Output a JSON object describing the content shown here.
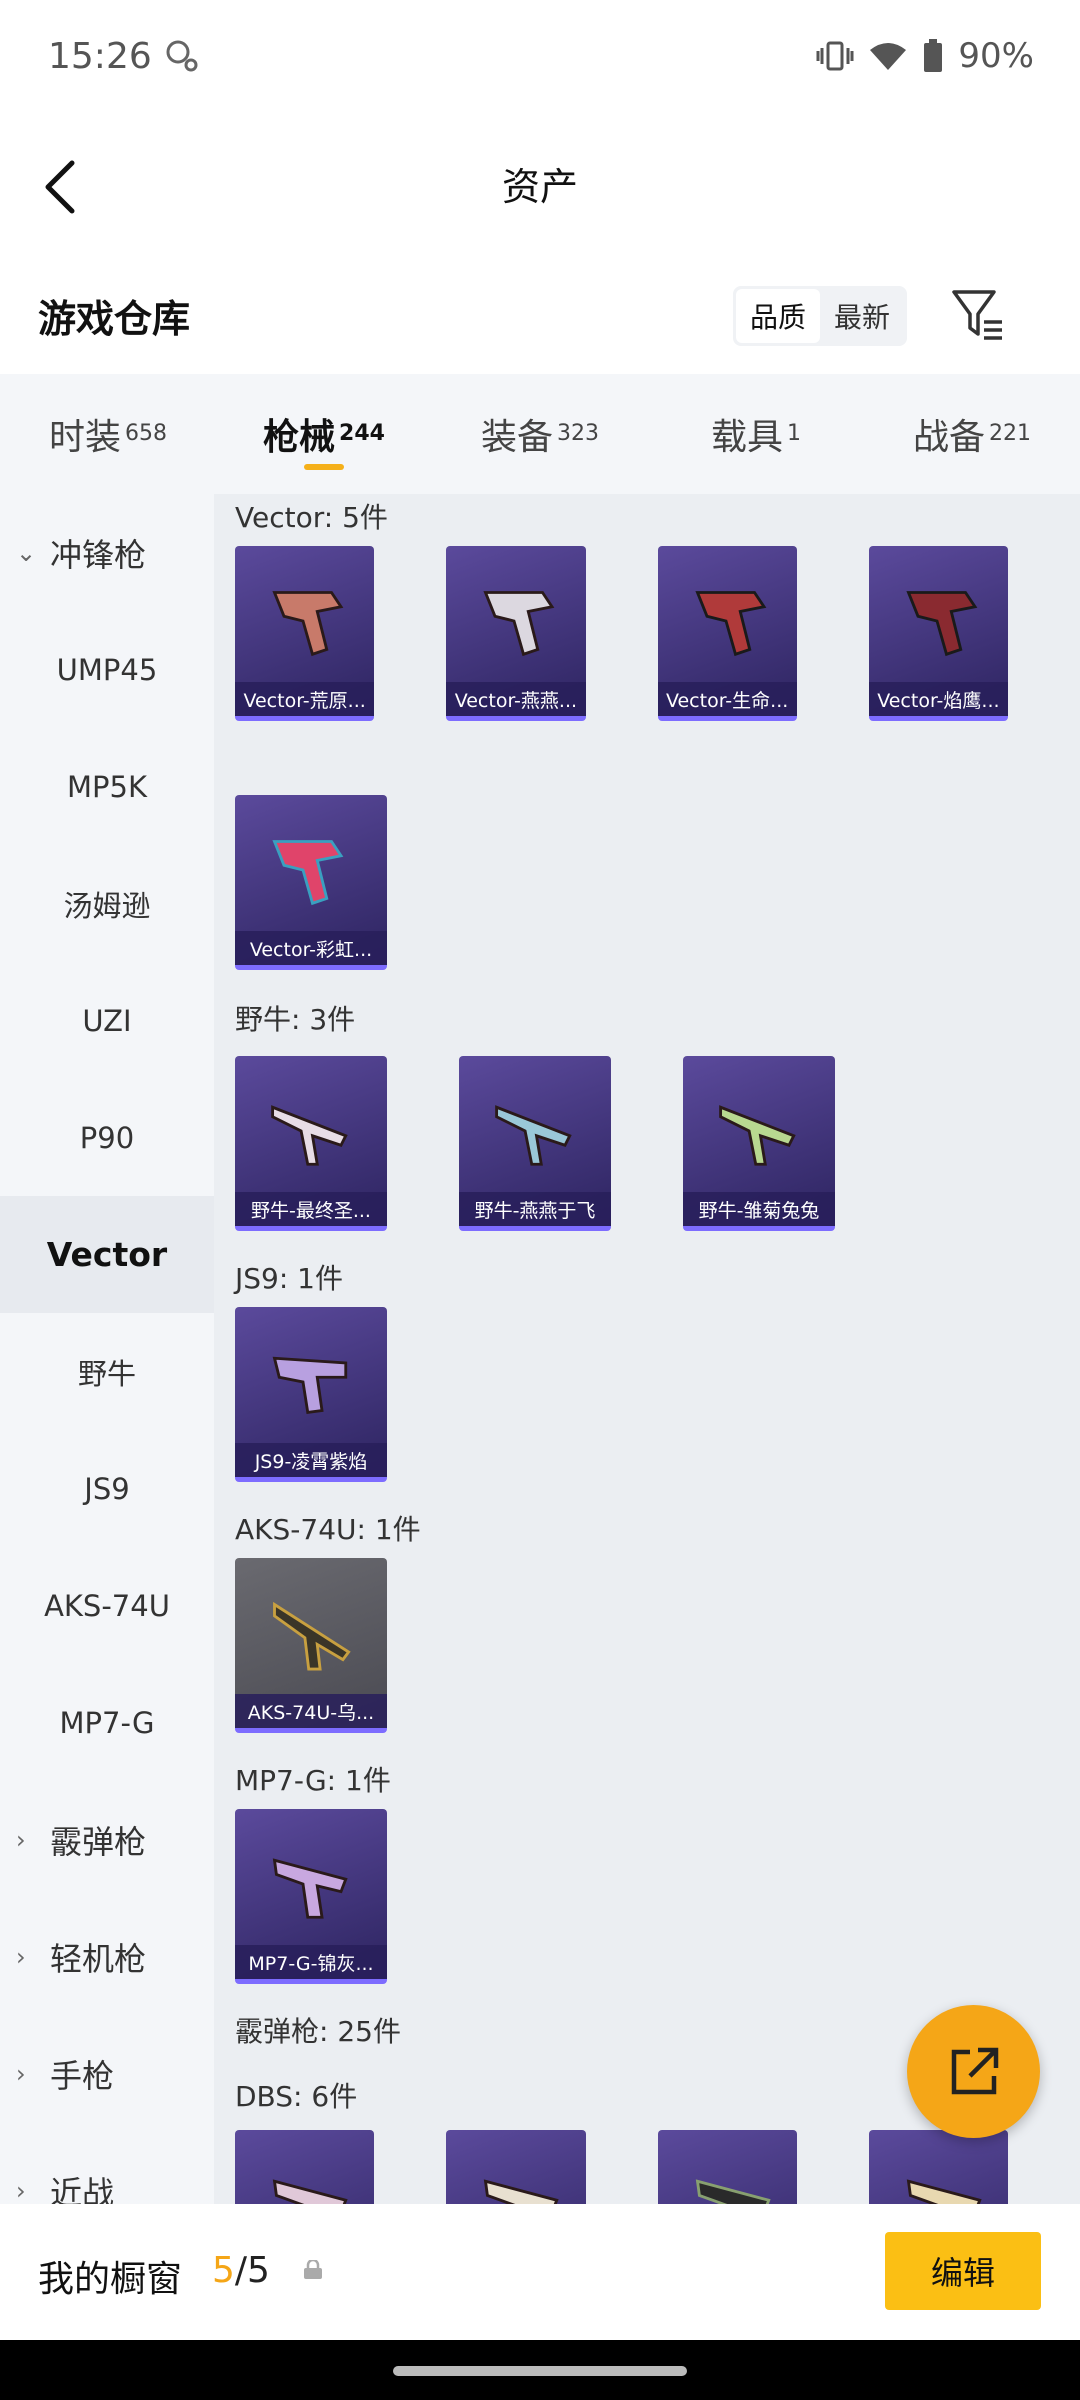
{
  "status": {
    "time": "15:26",
    "battery": "90%"
  },
  "nav": {
    "title": "资产"
  },
  "header": {
    "title": "游戏仓库",
    "sort_options": [
      "品质",
      "最新"
    ]
  },
  "tabs": [
    {
      "label": "时装",
      "count": "658"
    },
    {
      "label": "枪械",
      "count": "244"
    },
    {
      "label": "装备",
      "count": "323"
    },
    {
      "label": "载具",
      "count": "1"
    },
    {
      "label": "战备",
      "count": "221"
    }
  ],
  "sidebar": [
    {
      "label": "冲锋枪",
      "type": "category",
      "expanded": true
    },
    {
      "label": "UMP45"
    },
    {
      "label": "MP5K"
    },
    {
      "label": "汤姆逊"
    },
    {
      "label": "UZI"
    },
    {
      "label": "P90"
    },
    {
      "label": "Vector",
      "selected": true
    },
    {
      "label": "野牛"
    },
    {
      "label": "JS9"
    },
    {
      "label": "AKS-74U"
    },
    {
      "label": "MP7-G"
    },
    {
      "label": "霰弹枪",
      "type": "category"
    },
    {
      "label": "轻机枪",
      "type": "category"
    },
    {
      "label": "手枪",
      "type": "category"
    },
    {
      "label": "近战",
      "type": "category"
    }
  ],
  "sections": [
    {
      "title": "Vector: 5件",
      "items": [
        "Vector-荒原...",
        "Vector-燕燕...",
        "Vector-生命...",
        "Vector-焰鹰...",
        "Vector-彩虹..."
      ]
    },
    {
      "title": "野牛: 3件",
      "items": [
        "野牛-最终圣...",
        "野牛-燕燕于飞",
        "野牛-雏菊兔兔"
      ]
    },
    {
      "title": "JS9: 1件",
      "items": [
        "JS9-凌霄紫焰"
      ]
    },
    {
      "title": "AKS-74U: 1件",
      "items": [
        "AKS-74U-乌..."
      ]
    },
    {
      "title": "MP7-G: 1件",
      "items": [
        "MP7-G-锦灰..."
      ]
    },
    {
      "title": "霰弹枪: 25件",
      "items": []
    },
    {
      "title": "DBS: 6件",
      "items": [
        "",
        "",
        "",
        ""
      ]
    }
  ],
  "bottom": {
    "label": "我的橱窗",
    "count_current": "5",
    "count_total": "/5",
    "edit_label": "编辑"
  }
}
